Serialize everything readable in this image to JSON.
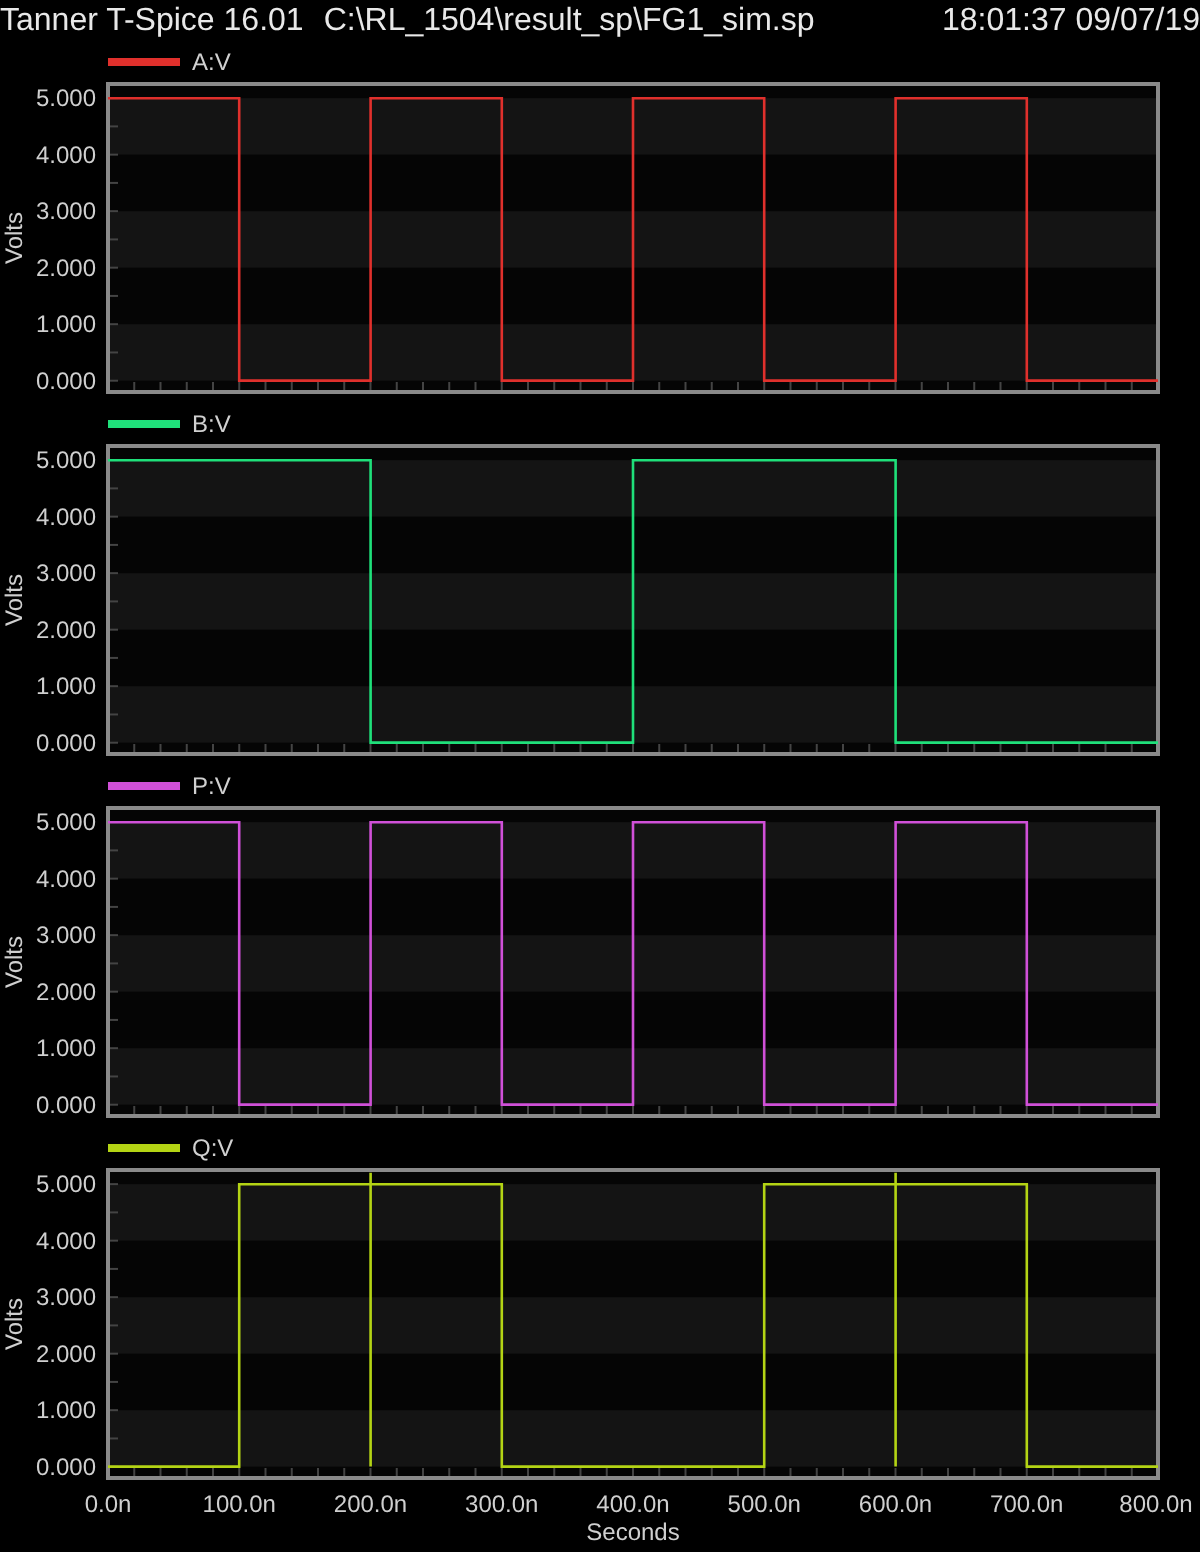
{
  "title_bar": {
    "app": "Tanner T-Spice 16.01",
    "file": "C:\\RL_1504\\result_sp\\FG1_sim.sp",
    "timestamp": "18:01:37 09/07/19"
  },
  "panels": [
    {
      "chart_data": {
        "type": "line",
        "ylabel": "Volts",
        "xlim": [
          0,
          800
        ],
        "ylim": [
          -0.2,
          5.25
        ],
        "yticks": [
          {
            "value": 0,
            "label": "0.000"
          },
          {
            "value": 1,
            "label": "1.000"
          },
          {
            "value": 2,
            "label": "2.000"
          },
          {
            "value": 3,
            "label": "3.000"
          },
          {
            "value": 4,
            "label": "4.000"
          },
          {
            "value": 5,
            "label": "5.000"
          }
        ],
        "x": [
          0,
          100,
          100,
          200,
          200,
          300,
          300,
          400,
          400,
          500,
          500,
          600,
          600,
          700,
          700,
          800
        ],
        "series": [
          {
            "name": "A:V",
            "color": "#e0302c",
            "values": [
              5,
              5,
              0,
              0,
              5,
              5,
              0,
              0,
              5,
              5,
              0,
              0,
              5,
              5,
              0,
              0
            ]
          }
        ]
      }
    },
    {
      "chart_data": {
        "type": "line",
        "ylabel": "Volts",
        "xlim": [
          0,
          800
        ],
        "ylim": [
          -0.2,
          5.25
        ],
        "yticks": [
          {
            "value": 0,
            "label": "0.000"
          },
          {
            "value": 1,
            "label": "1.000"
          },
          {
            "value": 2,
            "label": "2.000"
          },
          {
            "value": 3,
            "label": "3.000"
          },
          {
            "value": 4,
            "label": "4.000"
          },
          {
            "value": 5,
            "label": "5.000"
          }
        ],
        "x": [
          0,
          200,
          200,
          400,
          400,
          600,
          600,
          800
        ],
        "series": [
          {
            "name": "B:V",
            "color": "#1fe07a",
            "values": [
              5,
              5,
              0,
              0,
              5,
              5,
              0,
              0
            ]
          }
        ]
      }
    },
    {
      "chart_data": {
        "type": "line",
        "ylabel": "Volts",
        "xlim": [
          0,
          800
        ],
        "ylim": [
          -0.2,
          5.25
        ],
        "yticks": [
          {
            "value": 0,
            "label": "0.000"
          },
          {
            "value": 1,
            "label": "1.000"
          },
          {
            "value": 2,
            "label": "2.000"
          },
          {
            "value": 3,
            "label": "3.000"
          },
          {
            "value": 4,
            "label": "4.000"
          },
          {
            "value": 5,
            "label": "5.000"
          }
        ],
        "x": [
          0,
          100,
          100,
          200,
          200,
          300,
          300,
          400,
          400,
          500,
          500,
          600,
          600,
          700,
          700,
          800
        ],
        "series": [
          {
            "name": "P:V",
            "color": "#d050d8",
            "values": [
              5,
              5,
              0,
              0,
              5,
              5,
              0,
              0,
              5,
              5,
              0,
              0,
              5,
              5,
              0,
              0
            ]
          }
        ]
      }
    },
    {
      "chart_data": {
        "type": "line",
        "xlabel": "Seconds",
        "ylabel": "Volts",
        "xlim": [
          0,
          800
        ],
        "ylim": [
          -0.2,
          5.25
        ],
        "xticks": [
          {
            "value": 0,
            "label": "0.0n"
          },
          {
            "value": 100,
            "label": "100.0n"
          },
          {
            "value": 200,
            "label": "200.0n"
          },
          {
            "value": 300,
            "label": "300.0n"
          },
          {
            "value": 400,
            "label": "400.0n"
          },
          {
            "value": 500,
            "label": "500.0n"
          },
          {
            "value": 600,
            "label": "600.0n"
          },
          {
            "value": 700,
            "label": "700.0n"
          },
          {
            "value": 800,
            "label": "800.0n"
          }
        ],
        "yticks": [
          {
            "value": 0,
            "label": "0.000"
          },
          {
            "value": 1,
            "label": "1.000"
          },
          {
            "value": 2,
            "label": "2.000"
          },
          {
            "value": 3,
            "label": "3.000"
          },
          {
            "value": 4,
            "label": "4.000"
          },
          {
            "value": 5,
            "label": "5.000"
          }
        ],
        "x": [
          0,
          100,
          100,
          200,
          200,
          200,
          200,
          300,
          300,
          500,
          500,
          600,
          600,
          600,
          600,
          700,
          700,
          800
        ],
        "series": [
          {
            "name": "Q:V",
            "color": "#b4d414",
            "values": [
              0,
              0,
              5,
              5,
              0,
              5.2,
              5,
              5,
              0,
              0,
              5,
              5,
              0,
              5.2,
              5,
              5,
              0,
              0
            ]
          }
        ]
      }
    }
  ]
}
